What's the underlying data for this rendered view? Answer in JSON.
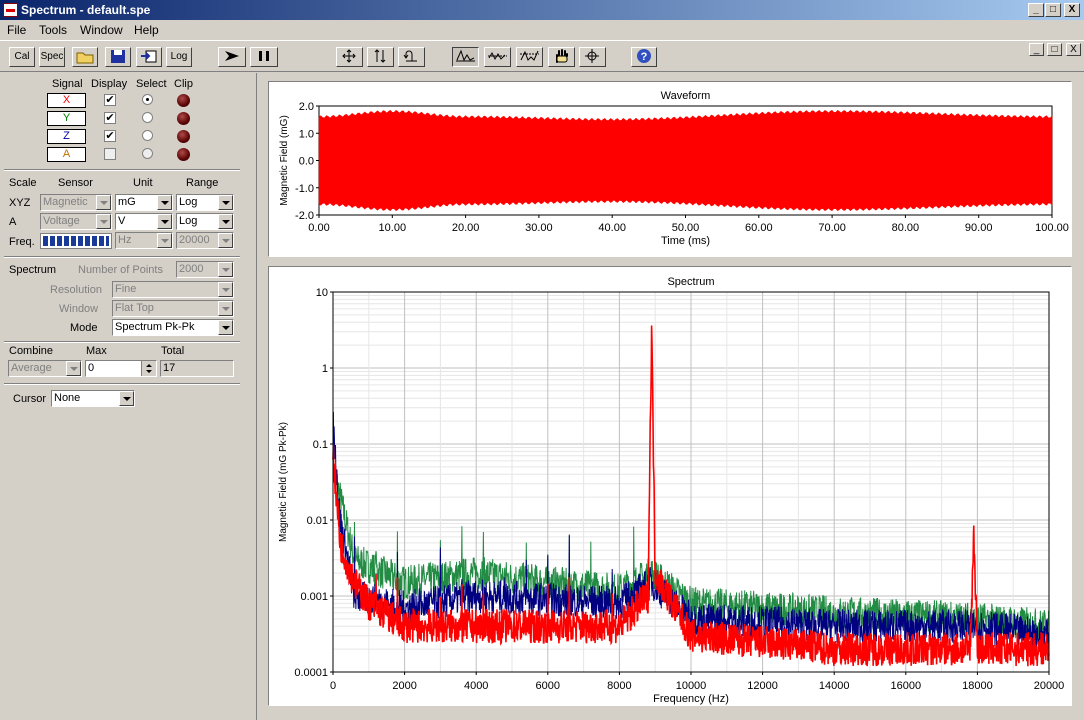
{
  "window": {
    "title": "Spectrum - default.spe",
    "controls": [
      "_",
      "□",
      "X"
    ],
    "mdi_controls": [
      "_",
      "□",
      "X"
    ]
  },
  "menu": [
    "File",
    "Tools",
    "Window",
    "Help"
  ],
  "toolbar": {
    "cal": "Cal",
    "spec": "Spec",
    "log": "Log"
  },
  "signal_panel": {
    "headers": [
      "Signal",
      "Display",
      "Select",
      "Clip"
    ],
    "signals": [
      {
        "name": "X",
        "color": "#ff0000",
        "display": true,
        "selected": true
      },
      {
        "name": "Y",
        "color": "#008000",
        "display": true,
        "selected": false
      },
      {
        "name": "Z",
        "color": "#0000a0",
        "display": true,
        "selected": false
      },
      {
        "name": "A",
        "color": "#c07000",
        "display": false,
        "selected": false
      }
    ]
  },
  "scale_panel": {
    "headers": [
      "Scale",
      "Sensor",
      "Unit",
      "Range"
    ],
    "xyz": {
      "label": "XYZ",
      "sensor": "Magnetic",
      "unit": "mG",
      "range": "Log"
    },
    "a": {
      "label": "A",
      "sensor": "Voltage",
      "unit": "V",
      "range": "Log"
    },
    "freq": {
      "label": "Freq.",
      "unit": "Hz",
      "range": "20000"
    }
  },
  "spectrum_panel": {
    "title": "Spectrum",
    "points_label": "Number of Points",
    "points": "2000",
    "resolution_label": "Resolution",
    "resolution": "Fine",
    "window_label": "Window",
    "window": "Flat Top",
    "mode_label": "Mode",
    "mode": "Spectrum Pk-Pk"
  },
  "combine_panel": {
    "combine_label": "Combine",
    "max_label": "Max",
    "total_label": "Total",
    "combine": "Average",
    "max": "0",
    "total": "17"
  },
  "cursor_panel": {
    "label": "Cursor",
    "value": "None"
  },
  "colors": {
    "x_trace": "#ff0000",
    "y_trace": "#228b44",
    "z_trace": "#000080"
  },
  "waveform": {
    "title": "Waveform",
    "xlabel": "Time (ms)",
    "ylabel": "Magnetic Field (mG)",
    "xticks": [
      "0.00",
      "10.00",
      "20.00",
      "30.00",
      "40.00",
      "50.00",
      "60.00",
      "70.00",
      "80.00",
      "90.00",
      "100.00"
    ],
    "yticks": [
      "2.0",
      "1.0",
      "0.0",
      "-1.0",
      "-2.0"
    ]
  },
  "spectrum_plot": {
    "title": "Spectrum",
    "xlabel": "Frequency (Hz)",
    "ylabel": "Magnetic Field (mG Pk-Pk)",
    "xticks": [
      "0",
      "2000",
      "4000",
      "6000",
      "8000",
      "10000",
      "12000",
      "14000",
      "16000",
      "18000",
      "20000"
    ],
    "yticks": [
      "10",
      "1",
      "0.1",
      "0.01",
      "0.001",
      "0.0001"
    ]
  },
  "chart_data": [
    {
      "type": "line",
      "title": "Waveform",
      "xlabel": "Time (ms)",
      "ylabel": "Magnetic Field (mG)",
      "xlim": [
        0,
        100
      ],
      "ylim": [
        -2,
        2
      ],
      "series": [
        {
          "name": "X",
          "amplitude_envelope": [
            [
              0,
              1.6
            ],
            [
              10,
              1.8
            ],
            [
              20,
              1.6
            ],
            [
              40,
              1.5
            ],
            [
              70,
              1.8
            ],
            [
              100,
              1.6
            ]
          ]
        }
      ],
      "grid": false
    },
    {
      "type": "line",
      "title": "Spectrum",
      "xlabel": "Frequency (Hz)",
      "ylabel": "Magnetic Field (mG Pk-Pk)",
      "xlim": [
        0,
        20000
      ],
      "ylim": [
        0.0001,
        10
      ],
      "yscale": "log",
      "grid": true,
      "series": [
        {
          "name": "X",
          "points": [
            [
              0,
              0.08
            ],
            [
              200,
              0.005
            ],
            [
              600,
              0.0015
            ],
            [
              1000,
              0.0008
            ],
            [
              2000,
              0.0004
            ],
            [
              4000,
              0.0004
            ],
            [
              6000,
              0.0004
            ],
            [
              8000,
              0.0004
            ],
            [
              8800,
              0.001
            ],
            [
              8900,
              3.5
            ],
            [
              9000,
              0.002
            ],
            [
              10000,
              0.0003
            ],
            [
              14000,
              0.0002
            ],
            [
              17800,
              0.0002
            ],
            [
              17900,
              0.007
            ],
            [
              18000,
              0.0002
            ],
            [
              20000,
              0.0002
            ]
          ]
        },
        {
          "name": "Y",
          "points": [
            [
              0,
              0.05
            ],
            [
              200,
              0.02
            ],
            [
              600,
              0.003
            ],
            [
              2000,
              0.0015
            ],
            [
              4000,
              0.002
            ],
            [
              6000,
              0.0015
            ],
            [
              8000,
              0.0012
            ],
            [
              8900,
              0.002
            ],
            [
              10000,
              0.0008
            ],
            [
              14000,
              0.0006
            ],
            [
              18000,
              0.0005
            ],
            [
              20000,
              0.0004
            ]
          ]
        },
        {
          "name": "Z",
          "points": [
            [
              0,
              0.2
            ],
            [
              200,
              0.01
            ],
            [
              600,
              0.001
            ],
            [
              2000,
              0.0007
            ],
            [
              4000,
              0.001
            ],
            [
              6000,
              0.0009
            ],
            [
              8000,
              0.0008
            ],
            [
              8900,
              0.0015
            ],
            [
              10000,
              0.0005
            ],
            [
              14000,
              0.0004
            ],
            [
              18000,
              0.0004
            ],
            [
              20000,
              0.0003
            ]
          ]
        }
      ]
    }
  ]
}
